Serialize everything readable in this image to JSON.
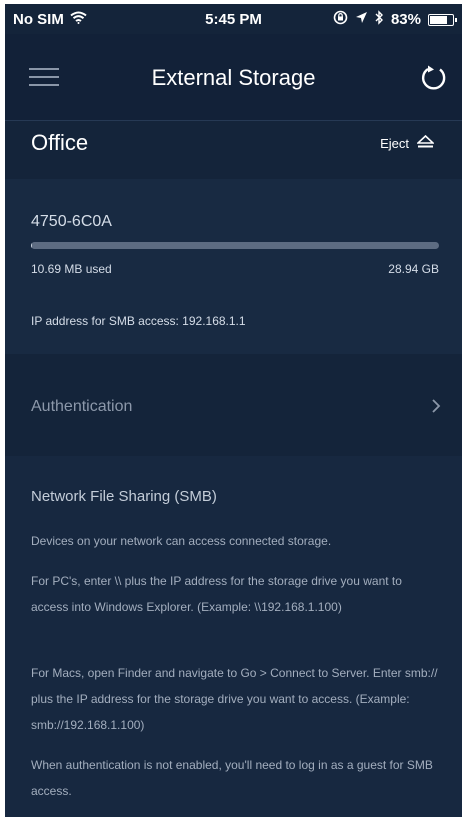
{
  "status_bar": {
    "carrier": "No SIM",
    "time": "5:45 PM",
    "battery": "83%",
    "battery_level": 0.83
  },
  "header": {
    "title": "External Storage"
  },
  "device": {
    "name": "Office",
    "eject_label": "Eject"
  },
  "drive": {
    "name": "4750-6C0A",
    "used": "10.69 MB used",
    "total": "28.94 GB",
    "used_fraction": 0.0004,
    "ip_text": "IP address for SMB access: 192.168.1.1"
  },
  "authentication": {
    "label": "Authentication"
  },
  "smb": {
    "title": "Network File Sharing (SMB)",
    "paragraphs": [
      "Devices on your network can access connected storage.",
      "For PC's, enter \\\\ plus the IP address for the storage drive you want to access into Windows Explorer. (Example: \\\\192.168.1.100)",
      "For Macs, open Finder and navigate to Go > Connect to Server. Enter smb:// plus the IP address for the storage drive you want to access. (Example: smb://192.168.1.100)",
      "When authentication is not enabled, you'll need to log in as a guest for SMB access."
    ]
  },
  "colors": {
    "background": "#14243a",
    "header": "#122138",
    "panel": "#182a42",
    "text_primary": "#ffffff",
    "text_muted": "#a3aebe"
  },
  "icons": [
    "wifi-icon",
    "lock-rotation-icon",
    "location-icon",
    "bluetooth-icon",
    "battery-icon",
    "menu-icon",
    "refresh-icon",
    "eject-icon",
    "chevron-right-icon"
  ]
}
